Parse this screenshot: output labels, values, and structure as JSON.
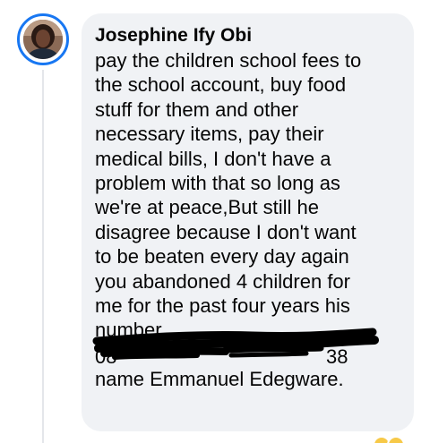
{
  "comment": {
    "author": "Josephine Ify Obi",
    "avatar_icon": "profile-photo",
    "lines": [
      "pay the children school fees to",
      "the school account, buy food",
      "stuff for them and other",
      "necessary items, pay their",
      "medical bills, I don't have a",
      "problem with that so long as",
      "we're at peace,But still he",
      "disagree because I don't want",
      "to be beaten every day again",
      "you abandoned 4 children for",
      "me for the past four years his",
      "number"
    ],
    "redacted_line": {
      "visible_prefix": "08",
      "visible_suffix": "38"
    },
    "last_line": "name Emmanuel Edegware."
  },
  "colors": {
    "avatar_ring": "#1877f2",
    "bubble_background": "#f0f2f5",
    "text": "#050505",
    "thread_line": "#e4e6ea",
    "reaction": "#f7c948"
  }
}
